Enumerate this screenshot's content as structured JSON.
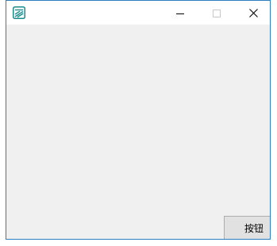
{
  "window": {
    "title": "",
    "app_icon": "app-logo-icon",
    "border_color": "#2b7fc0",
    "controls": {
      "minimize_icon": "minimize-icon",
      "maximize_icon": "maximize-icon",
      "close_icon": "close-icon"
    }
  },
  "client": {
    "background": "#f0f0f0",
    "button_label": "按钮"
  }
}
